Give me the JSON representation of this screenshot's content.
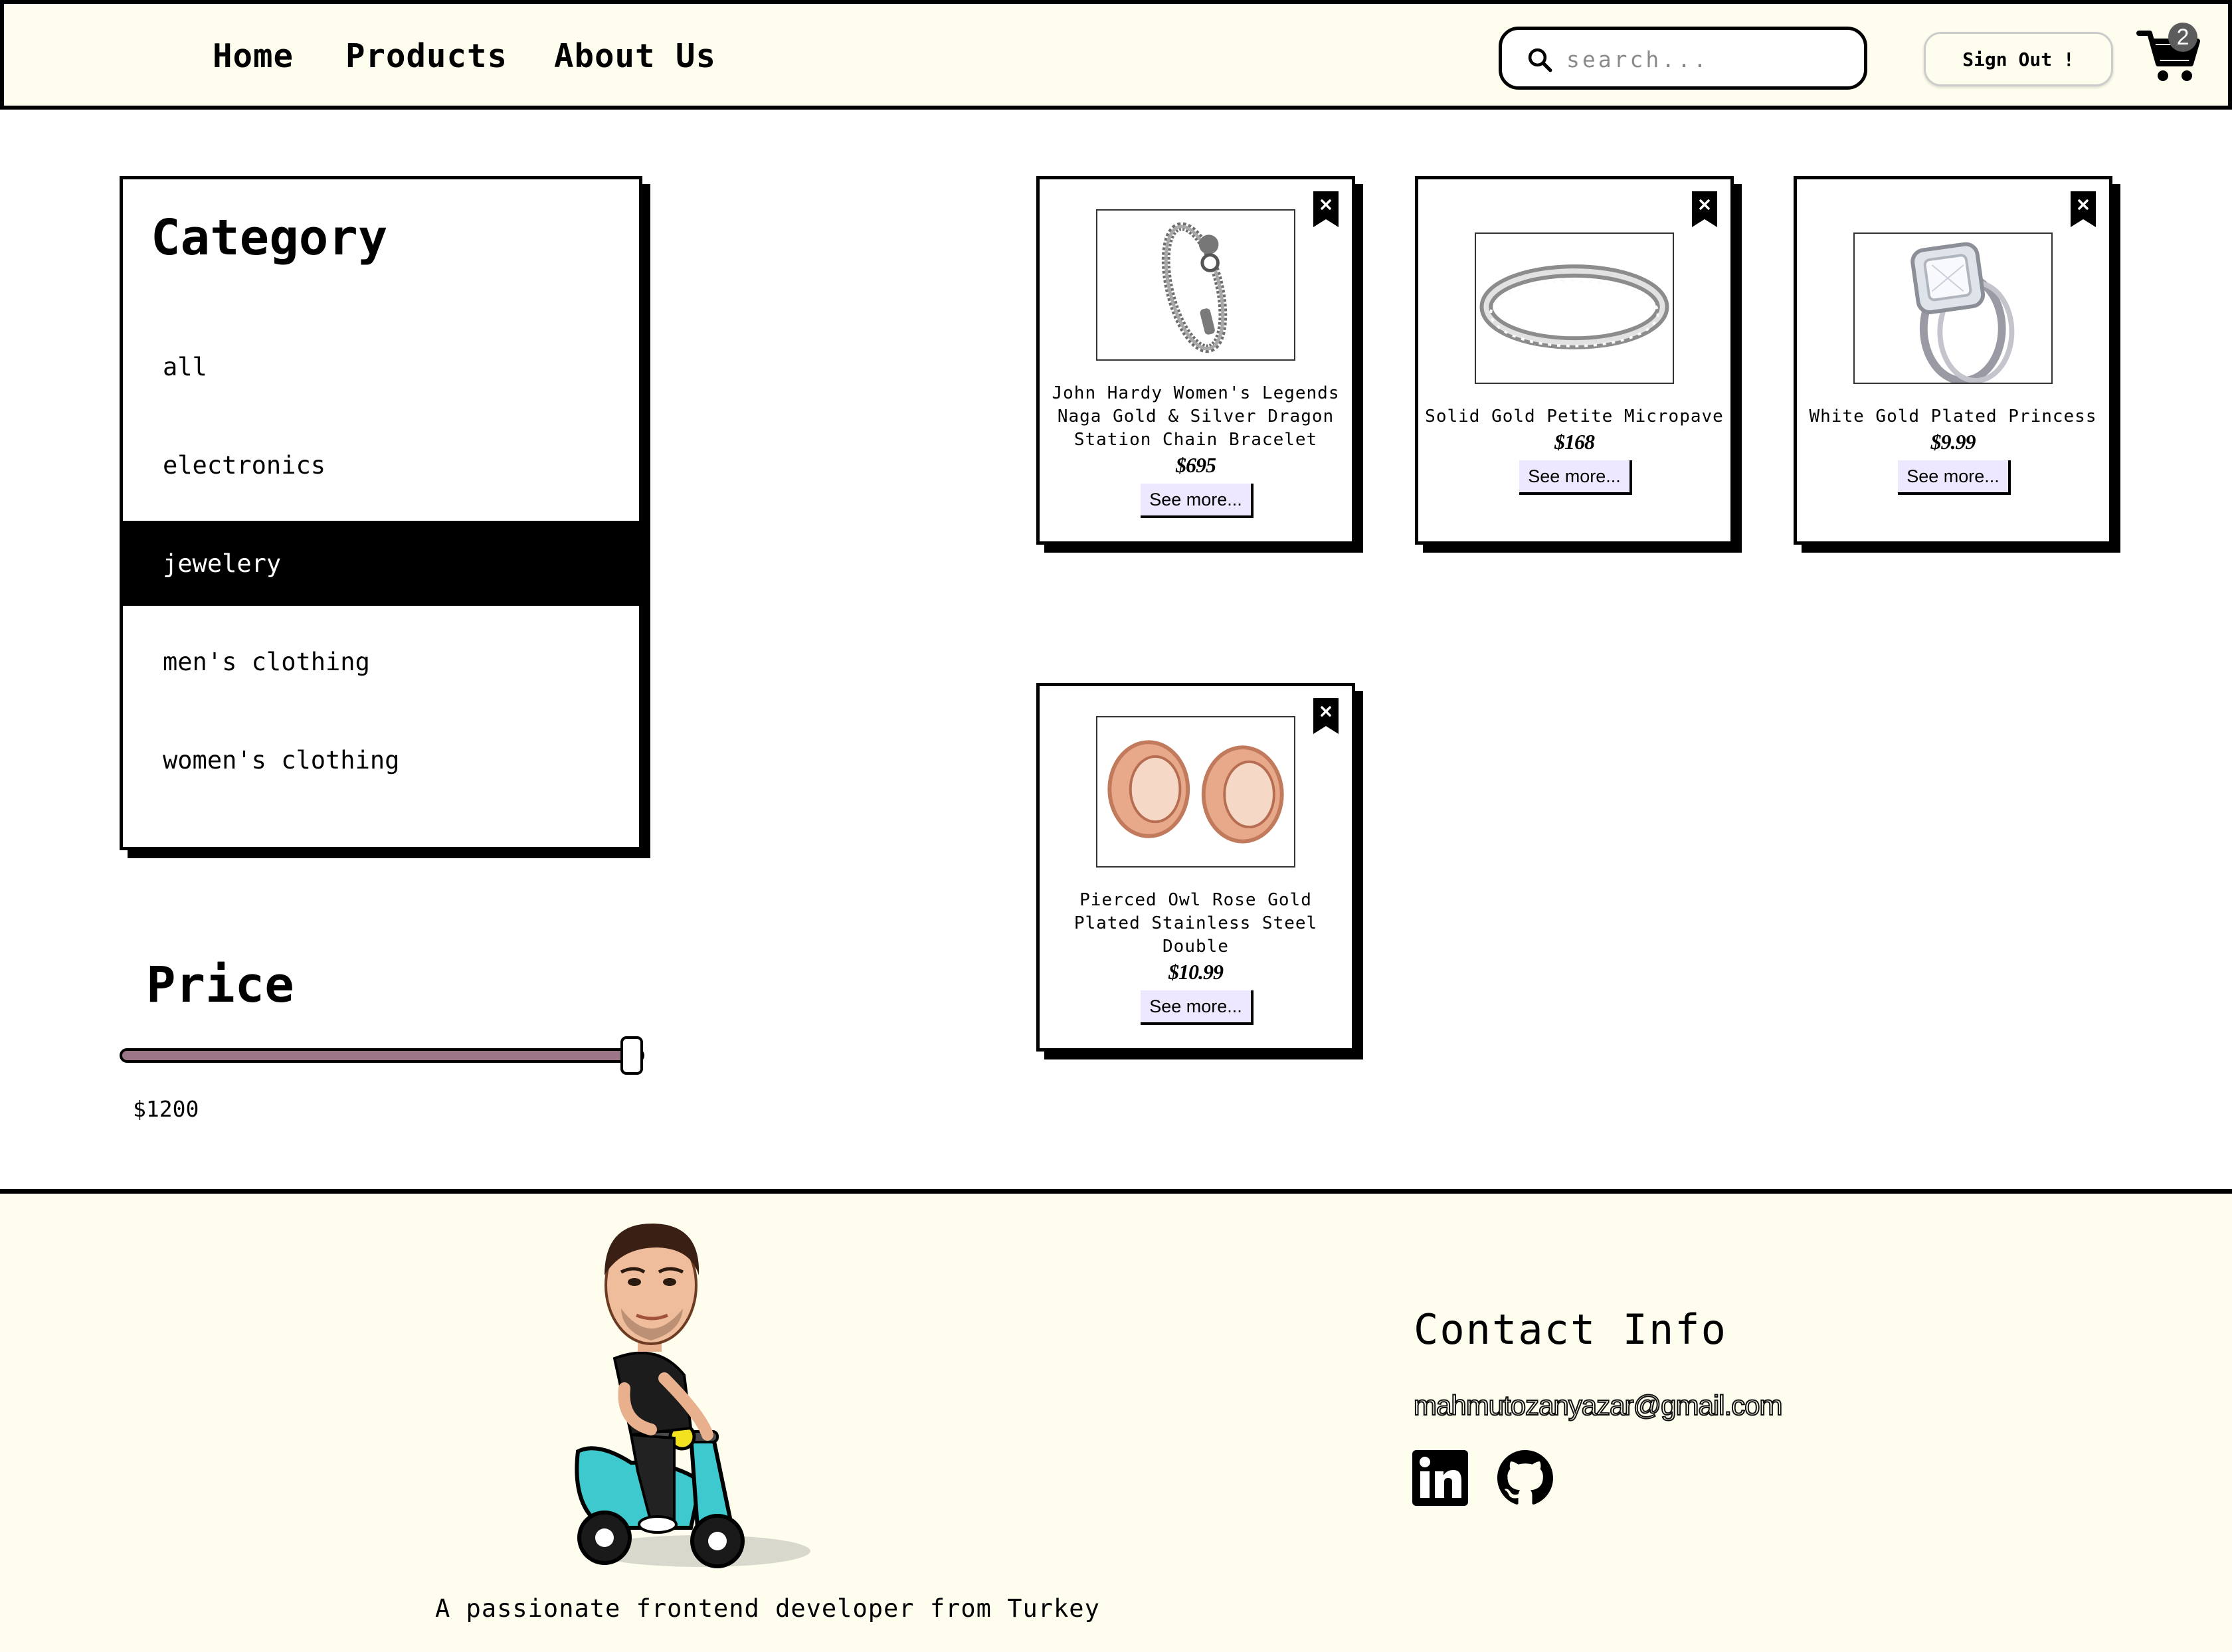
{
  "header": {
    "nav": [
      {
        "label": "Home"
      },
      {
        "label": "Products"
      },
      {
        "label": "About Us"
      }
    ],
    "search": {
      "placeholder": "search...",
      "icon": "search-icon"
    },
    "sign_out_label": "Sign Out !",
    "cart": {
      "icon": "cart-icon",
      "count": "2"
    }
  },
  "sidebar": {
    "category_title": "Category",
    "categories": [
      {
        "label": "all"
      },
      {
        "label": "electronics"
      },
      {
        "label": "jewelery",
        "selected": true
      },
      {
        "label": "men's clothing"
      },
      {
        "label": "women's clothing"
      }
    ],
    "price_title": "Price",
    "price_value_label": "$1200",
    "price_slider_fraction": 1.0
  },
  "products": [
    {
      "title": "John Hardy Women's Legends Naga Gold & Silver Dragon Station Chain Bracelet",
      "price": "$695",
      "see_more": "See more...",
      "image": "bracelet"
    },
    {
      "title": "Solid Gold Petite Micropave",
      "price": "$168",
      "see_more": "See more...",
      "image": "ring-band"
    },
    {
      "title": "White Gold Plated Princess",
      "price": "$9.99",
      "see_more": "See more...",
      "image": "diamond-ring"
    },
    {
      "title": "Pierced Owl Rose Gold Plated Stainless Steel Double",
      "price": "$10.99",
      "see_more": "See more...",
      "image": "ear-plugs"
    }
  ],
  "footer": {
    "tagline": "A passionate frontend developer from Turkey",
    "contact_title": "Contact Info",
    "email": "mahmutozanyazar@gmail.com",
    "social": [
      {
        "icon": "linkedin-icon"
      },
      {
        "icon": "github-icon"
      }
    ]
  },
  "colors": {
    "header_bg": "#fffdee",
    "footer_bg": "#fffdee",
    "slider_fill": "#9a7686",
    "see_more_bg": "#ede8ff",
    "selected_category_bg": "#000000"
  }
}
